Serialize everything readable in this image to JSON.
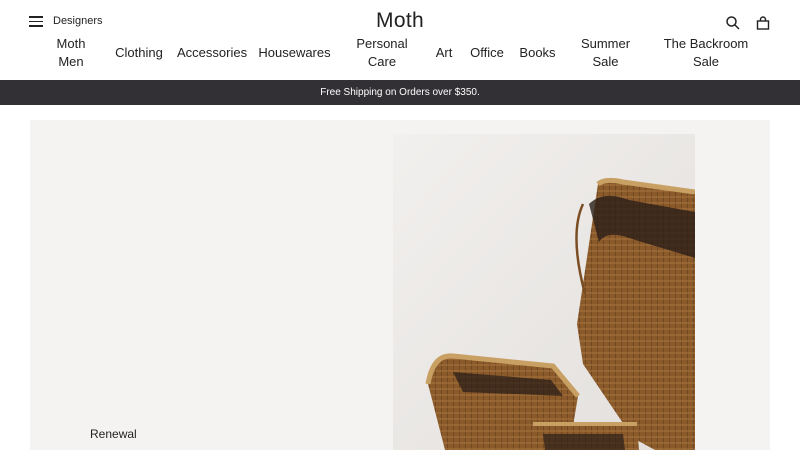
{
  "header": {
    "menu_icon": "hamburger-menu-icon",
    "designers_label": "Designers",
    "brand": "Moth",
    "search_icon": "search-icon",
    "bag_icon": "shopping-bag-icon"
  },
  "nav": [
    {
      "label": "Moth\nMen"
    },
    {
      "label": "Clothing"
    },
    {
      "label": "Accessories"
    },
    {
      "label": "Housewares"
    },
    {
      "label": "Personal\nCare"
    },
    {
      "label": "Art"
    },
    {
      "label": "Office"
    },
    {
      "label": "Books"
    },
    {
      "label": "Summer\nSale"
    },
    {
      "label": "The Backroom\nSale"
    }
  ],
  "promo": {
    "text": "Free Shipping on Orders over $350."
  },
  "hero": {
    "label": "Renewal",
    "image": "woven bamboo baskets"
  },
  "colors": {
    "promo_bg": "#323034",
    "hero_bg": "#f4f3f2",
    "basket": "#8a5a2b"
  }
}
